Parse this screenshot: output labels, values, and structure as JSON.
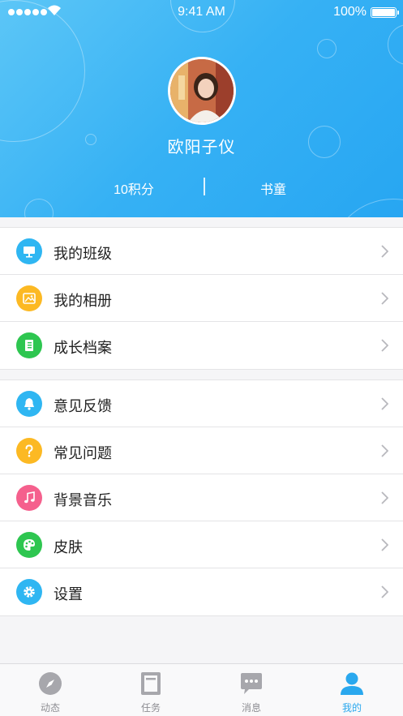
{
  "status_bar": {
    "time": "9:41 AM",
    "battery": "100%"
  },
  "profile": {
    "name": "欧阳子仪",
    "points": "10积分",
    "level": "书童"
  },
  "menu_group_1": [
    {
      "label": "我的班级",
      "icon": "classroom-icon",
      "color": "#2fb6f2"
    },
    {
      "label": "我的相册",
      "icon": "album-icon",
      "color": "#fcb923"
    },
    {
      "label": "成长档案",
      "icon": "growth-archive-icon",
      "color": "#2ec650"
    }
  ],
  "menu_group_2": [
    {
      "label": "意见反馈",
      "icon": "feedback-bell-icon",
      "color": "#2fb6f2"
    },
    {
      "label": "常见问题",
      "icon": "faq-question-icon",
      "color": "#fcb923"
    },
    {
      "label": "背景音乐",
      "icon": "music-note-icon",
      "color": "#f5608d"
    },
    {
      "label": "皮肤",
      "icon": "palette-icon",
      "color": "#2ec650"
    },
    {
      "label": "设置",
      "icon": "gear-icon",
      "color": "#2fb6f2"
    }
  ],
  "tabs": [
    {
      "label": "动态",
      "icon": "compass-icon",
      "active": false
    },
    {
      "label": "任务",
      "icon": "task-doc-icon",
      "active": false
    },
    {
      "label": "消息",
      "icon": "chat-bubble-icon",
      "active": false
    },
    {
      "label": "我的",
      "icon": "person-icon",
      "active": true
    }
  ],
  "colors": {
    "header_start": "#5cc6f7",
    "header_end": "#27a6f2",
    "tab_active": "#2aa8ee",
    "tab_inactive": "#8e8e93"
  }
}
